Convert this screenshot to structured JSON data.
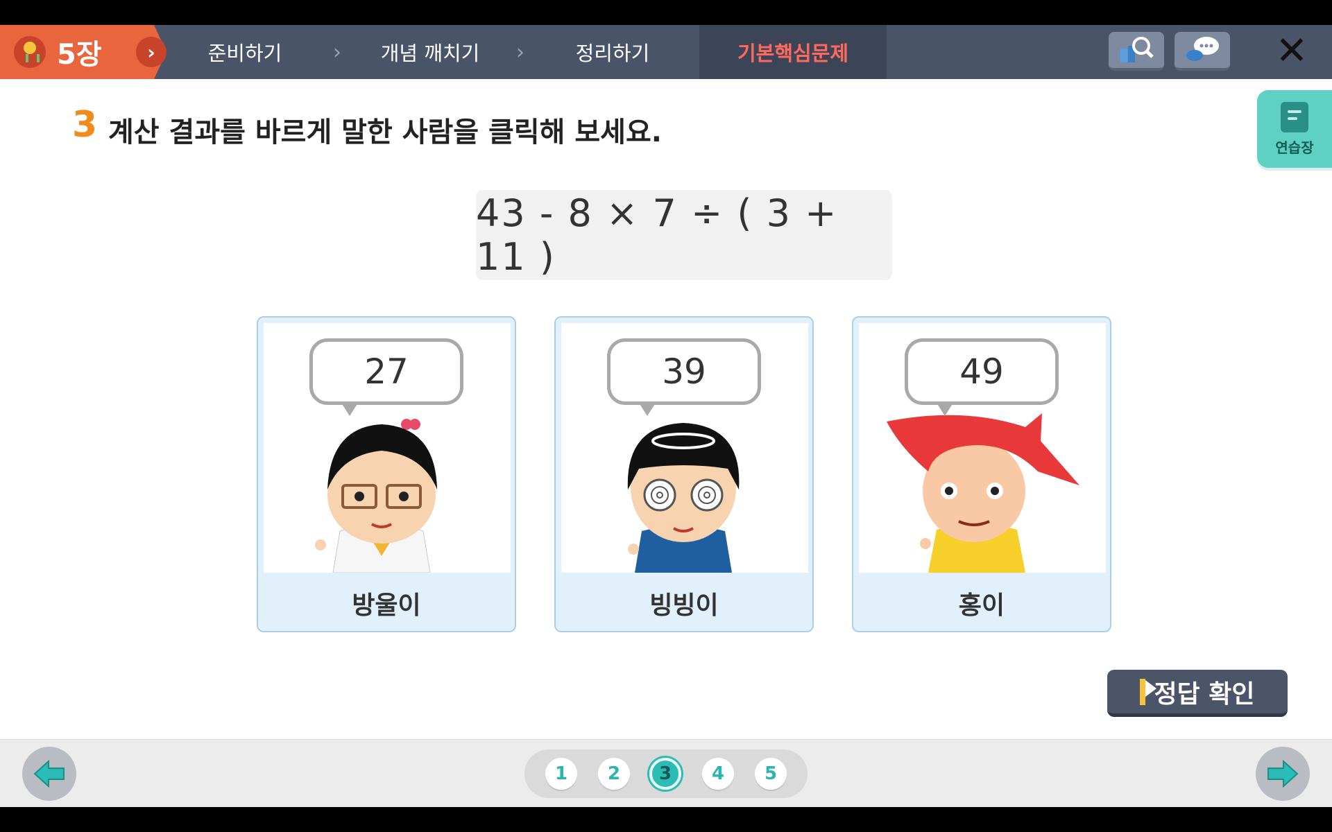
{
  "nav": {
    "chapter_title": "5장",
    "chapter_button": "›",
    "steps": [
      "준비하기",
      "개념 깨치기",
      "정리하기",
      "기본핵심문제"
    ],
    "active_step_index": 3,
    "tools": [
      "search-tool",
      "chat-tool"
    ],
    "close_label": "✕"
  },
  "question": {
    "number": "3",
    "text": "계산 결과를 바르게 말한 사람을 클릭해 보세요.",
    "expression": "43 - 8 × 7 ÷ ( 3 + 11 )"
  },
  "practice_pad": {
    "label": "연습장"
  },
  "cards": [
    {
      "value": "27",
      "name": "방울이"
    },
    {
      "value": "39",
      "name": "빙빙이"
    },
    {
      "value": "49",
      "name": "홍이"
    }
  ],
  "answer_button": {
    "label": "정답 확인"
  },
  "pager": {
    "pages": [
      "1",
      "2",
      "3",
      "4",
      "5"
    ],
    "current": "3"
  },
  "colors": {
    "accent": "#2bbcb6",
    "chapter": "#e8653d",
    "active_step": "#ff6a5c",
    "question_number": "#f28a1c"
  }
}
